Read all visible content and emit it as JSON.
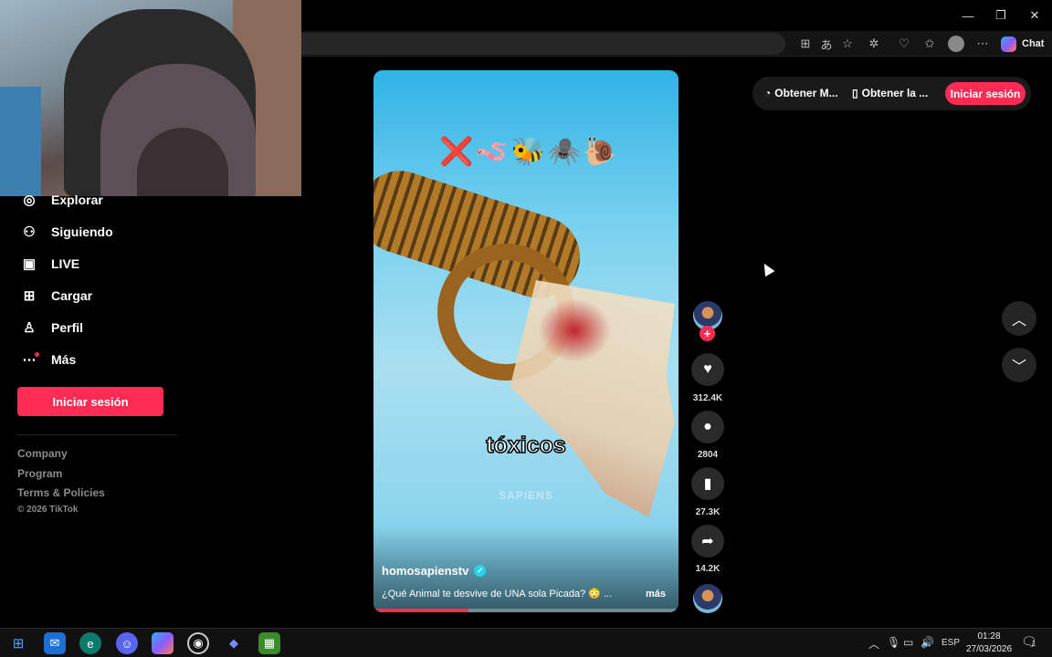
{
  "browser": {
    "chat_label": "Chat"
  },
  "sidebar": {
    "items": [
      {
        "label": "Explorar",
        "icon": "compass-icon"
      },
      {
        "label": "Siguiendo",
        "icon": "following-icon"
      },
      {
        "label": "LIVE",
        "icon": "live-icon"
      },
      {
        "label": "Cargar",
        "icon": "upload-icon"
      },
      {
        "label": "Perfil",
        "icon": "profile-icon"
      },
      {
        "label": "Más",
        "icon": "more-icon"
      }
    ],
    "login_button": "Iniciar sesión",
    "footer_links": [
      "Company",
      "Program",
      "Terms & Policies"
    ],
    "copyright": "© 2026 TikTok"
  },
  "header": {
    "get_app_label": "Obtener M...",
    "get_tv_label": "Obtener la ...",
    "login_button": "Iniciar sesión"
  },
  "video": {
    "emoji_row": "❌🪱🐝🕷️🐌",
    "caption_word": "tóxicos",
    "watermark": "SAPIENS",
    "username": "homosapienstv",
    "description": "¿Qué Animal te desvive de UNA sola Picada? 😳 ...",
    "more_label": "más",
    "progress": 0.31
  },
  "actions": {
    "likes": "312.4K",
    "comments": "2804",
    "saves": "27.3K",
    "shares": "14.2K"
  },
  "taskbar": {
    "language": "ESP",
    "time": "01:28",
    "date": "27/03/2026",
    "notification_count": "1"
  },
  "colors": {
    "accent": "#fe2c55",
    "verified": "#20d5ec"
  }
}
